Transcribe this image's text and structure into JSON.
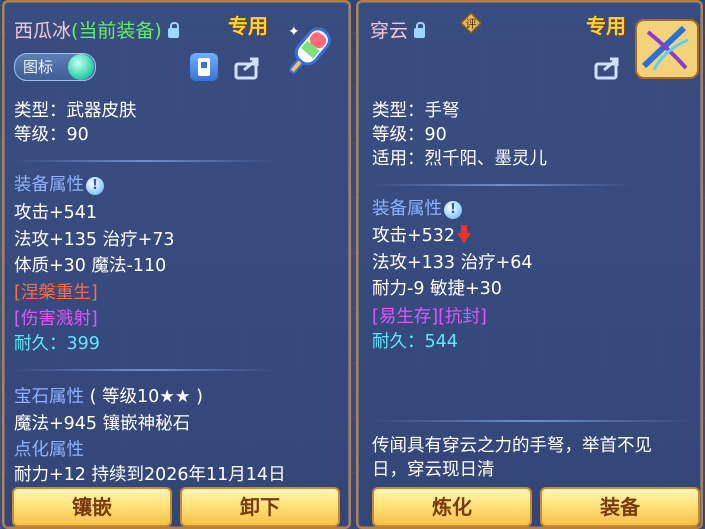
{
  "left": {
    "name": "西瓜冰",
    "status": "(当前装备)",
    "exclusive": "专用",
    "toggle_label": "图标",
    "type_line": "类型：武器皮肤",
    "level_line": "等级：90",
    "attr_header": "装备属性",
    "info_mark": "!",
    "stats": [
      "攻击+541",
      "法攻+135 治疗+73",
      "体质+30 魔法-110"
    ],
    "special_1": "[涅槃重生]",
    "special_2": "[伤害溅射]",
    "durability_label": "耐久：",
    "durability_value": "399",
    "gem_header": "宝石属性",
    "gem_level": "( 等级10★★ )",
    "gem_stat": "魔法+945 镶嵌神秘石",
    "refine_header": "点化属性",
    "refine_stat": "耐力+12 持续到2026年11月14日",
    "btn_inlay": "镶嵌",
    "btn_unequip": "卸下"
  },
  "right": {
    "name": "穿云",
    "eval_mark": "评",
    "exclusive": "专用",
    "type_line": "类型：手弩",
    "level_line": "等级：90",
    "fit_line": "适用：烈千阳、墨灵儿",
    "attr_header": "装备属性",
    "info_mark": "!",
    "stat_1": "攻击+532",
    "stat_2": "法攻+133 治疗+64",
    "stat_3": "耐力-9 敏捷+30",
    "special": "[易生存][抗封]",
    "durability_label": "耐久：",
    "durability_value": "544",
    "description_1": "传闻具有穿云之力的手弩，举首不见",
    "description_2": "日，穿云现日清",
    "btn_refine": "炼化",
    "btn_equip": "装备"
  },
  "colors": {
    "accent_gold": "#ffd23a",
    "name_pink": "#f4c7d6",
    "status_green": "#5ff06a",
    "section_blue": "#8fb2ff",
    "special_red": "#ff6b4a",
    "special_purple": "#e055ff",
    "durability_cyan": "#5ee8ff"
  },
  "icons": [
    "lock-icon",
    "popsicle-weapon-icon",
    "crossbow-weapon-icon",
    "share-icon",
    "info-icon",
    "arrow-down-icon",
    "appearance-icon"
  ]
}
